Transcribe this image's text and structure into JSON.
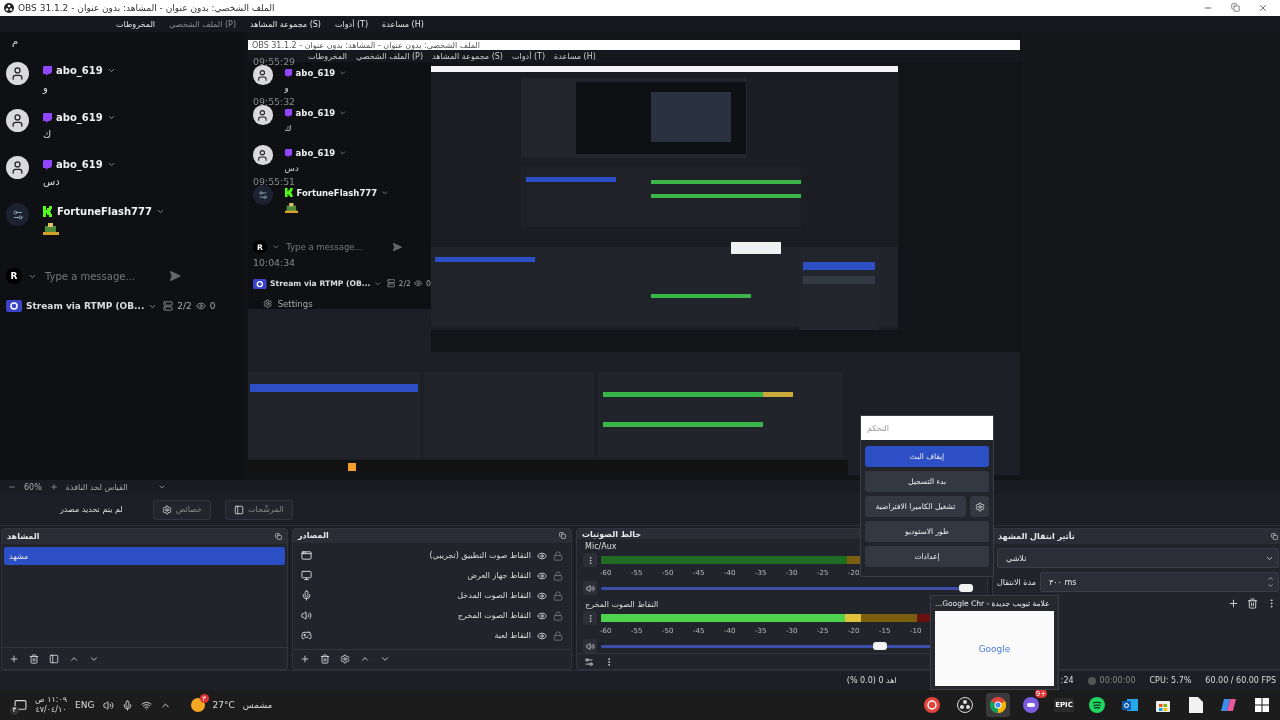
{
  "window": {
    "title": "الملف الشخصي: بدون عنوان - المشاهد: بدون عنوان - OBS 31.1.2"
  },
  "menu": [
    {
      "label": "مساعدة (H)",
      "disabled": false
    },
    {
      "label": "أدوات (T)",
      "disabled": false
    },
    {
      "label": "مجموعة المشاهد (S)",
      "disabled": false
    },
    {
      "label": "الملف الشخصي (P)",
      "disabled": true
    },
    {
      "label": "المخروطات",
      "disabled": false
    }
  ],
  "preview": {
    "chat": {
      "messages": [
        {
          "kind": "text",
          "text": "م"
        },
        {
          "kind": "twitch",
          "user": "abo_619",
          "text": "و"
        },
        {
          "kind": "twitch",
          "user": "abo_619",
          "text": "ك"
        },
        {
          "kind": "twitch",
          "user": "abo_619",
          "text": "دس"
        },
        {
          "kind": "kick",
          "user": "FortuneFlash777",
          "emote": true
        }
      ],
      "account": "R",
      "placeholder": "Type a message...",
      "stream": {
        "name": "Stream via RTMP (OB...",
        "connections": "2/2",
        "viewers": "0"
      }
    },
    "nested_window": {
      "title": "الملف الشخصي: بدون عنوان - المشاهد: بدون عنوان - OBS 31.1.2",
      "menu": [
        "مساعدة (H)",
        "أدوات (T)",
        "مجموعة المشاهد (S)",
        "الملف الشخصي (P)",
        "المخروطات"
      ],
      "chat": {
        "messages": [
          {
            "kind": "twitch",
            "user": "abo_619",
            "text": "و",
            "time": "09:55:29"
          },
          {
            "kind": "twitch",
            "user": "abo_619",
            "text": "ك",
            "time": "09:55:32"
          },
          {
            "kind": "twitch",
            "user": "abo_619",
            "text": "دس"
          },
          {
            "kind": "kick",
            "user": "FortuneFlash777",
            "emote": true,
            "time": "09:55:51"
          }
        ],
        "account": "R",
        "placeholder": "Type a message...",
        "input_time": "10:04:34",
        "stream": {
          "name": "Stream via RTMP (OB...",
          "connections": "2/2",
          "viewers": "0"
        },
        "settings": "Settings"
      }
    }
  },
  "controls_popup": {
    "title": "التحكم",
    "buttons": [
      {
        "label": "إيقاف البث",
        "selected": true,
        "gear": false
      },
      {
        "label": "بدء التسجيل",
        "selected": false,
        "gear": false
      },
      {
        "label": "تشغيل الكاميرا الافتراضية",
        "selected": false,
        "gear": true
      },
      {
        "label": "طور الاستوديو",
        "selected": false,
        "gear": false
      },
      {
        "label": "إعدادات",
        "selected": false,
        "gear": false
      }
    ]
  },
  "zoom_bar": {
    "zoom": "60%",
    "scale_mode": "القياس لحد النافذة"
  },
  "source_bar": {
    "status": "لم يتم تحديد مصدر",
    "properties": "خصائص",
    "filters": "المرشّحات"
  },
  "scenes": {
    "title": "المشاهد",
    "items": [
      {
        "name": "مشهد",
        "selected": true
      }
    ]
  },
  "sources": {
    "title": "المصادر",
    "items": [
      {
        "name": "التقاط صوت التطبيق (تجريبي)",
        "kind": "app_audio"
      },
      {
        "name": "التقاط جهاز العرض",
        "kind": "display"
      },
      {
        "name": "التقاط الصوت المدخل",
        "kind": "mic"
      },
      {
        "name": "التقاط الصوت المخرج",
        "kind": "speaker"
      },
      {
        "name": "التقاط لعبة",
        "kind": "game"
      }
    ]
  },
  "mixer": {
    "title": "خالط الصوتيات",
    "channels": [
      {
        "name": "Mic/Aux",
        "volume": {
          "level": 0.98
        },
        "ticks": [
          "-20",
          "-25",
          "-30",
          "-35",
          "-40",
          "-45",
          "-50",
          "-55",
          "-60"
        ]
      },
      {
        "name": "التقاط الصوت المخرج",
        "meter": {
          "level": 0.7
        },
        "volume": {
          "level": 0.75
        },
        "ticks": [
          "-10",
          "-15",
          "-20",
          "-25",
          "-30",
          "-35",
          "-40",
          "-45",
          "-50",
          "-55",
          "-60"
        ]
      }
    ]
  },
  "transitions": {
    "title": "تأثير انتقال المشهد",
    "effect": "تلاشي",
    "duration_label": "مدة الانتقال",
    "duration": "٣٠٠ ms"
  },
  "thumbnail": {
    "title": "علامة تبويب جديدة - Google Chr...",
    "page_logo": "Google"
  },
  "status_bar": {
    "frames": "اهد 0 (0.0 %)",
    "time_fragment": ":24",
    "record_time": "00:00:00",
    "cpu": "CPU: 5.7%",
    "fps": "60.00 / 60.00 FPS"
  },
  "taskbar": {
    "notifications": "٣",
    "time": "١١:٠٩ ص",
    "date": "٤٧/٠٤/١٠",
    "language": "ENG",
    "weather_badge": "٣",
    "temperature": "27°C",
    "weather": "مشمس",
    "apps": [
      {
        "kind": "r_app",
        "active": false
      },
      {
        "kind": "obs",
        "active": false
      },
      {
        "kind": "chrome",
        "active": true
      },
      {
        "kind": "game_app",
        "badge": "9+",
        "active": false
      },
      {
        "kind": "epic",
        "label": "EPIC",
        "active": false
      },
      {
        "kind": "spotify",
        "active": false
      },
      {
        "kind": "outlook",
        "active": false
      },
      {
        "kind": "store",
        "active": false
      },
      {
        "kind": "file",
        "active": false
      },
      {
        "kind": "copilot",
        "active": false
      },
      {
        "kind": "windows",
        "active": false
      }
    ]
  }
}
